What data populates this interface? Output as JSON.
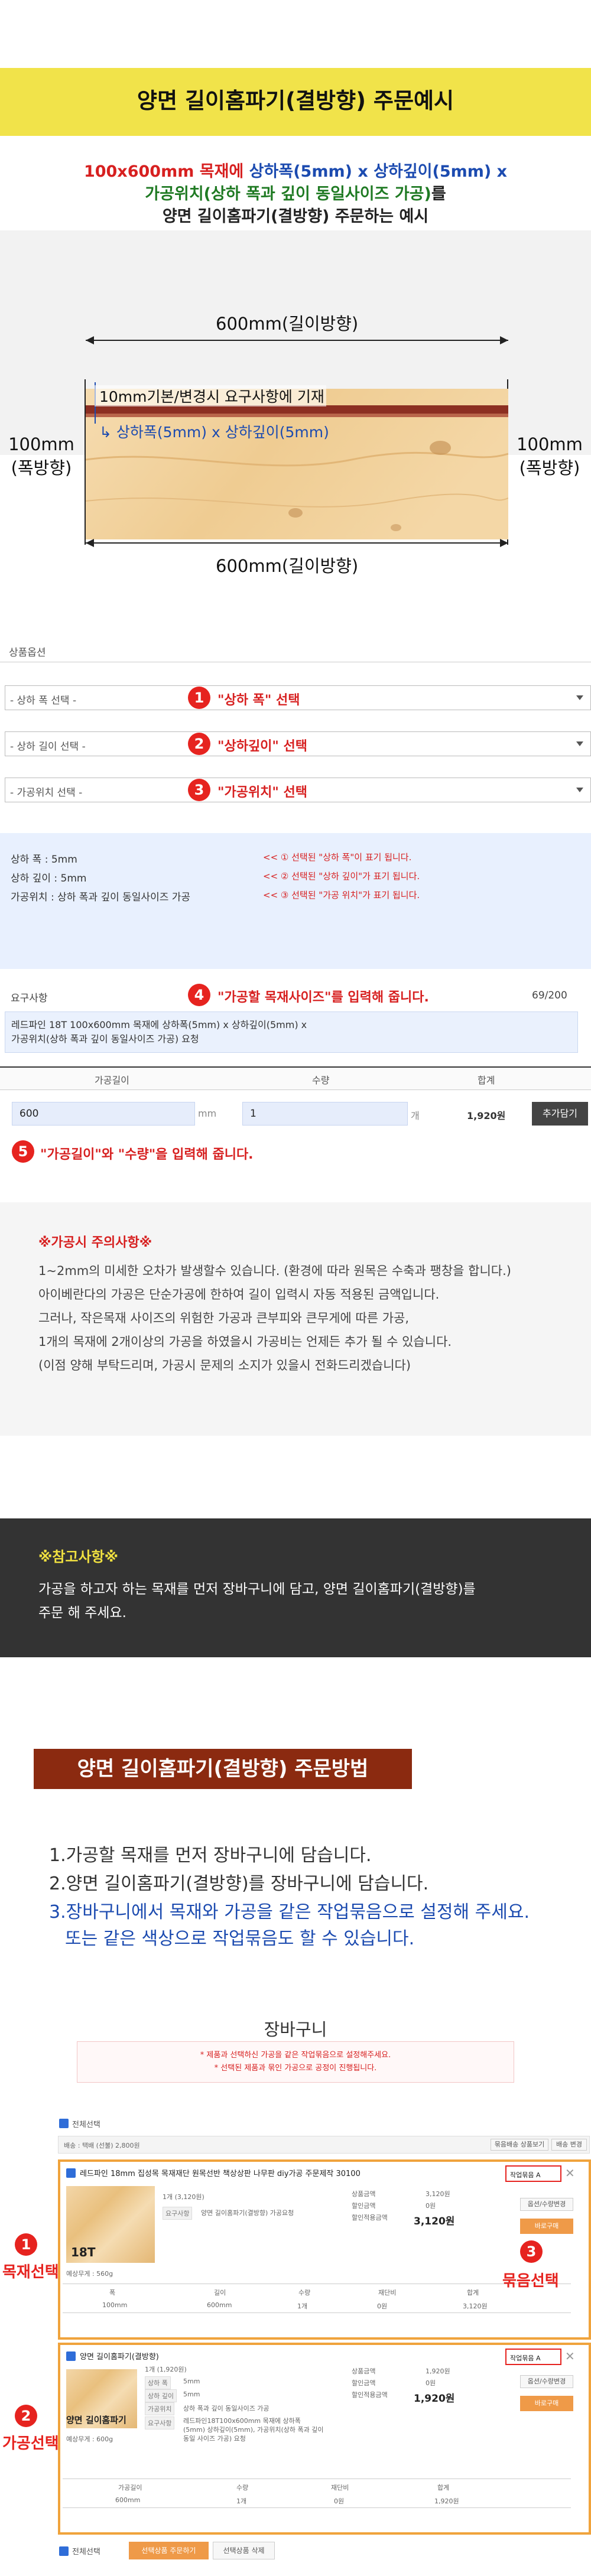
{
  "header": {
    "title": "양면 길이홈파기(결방향) 주문예시"
  },
  "intro": {
    "line1_a": "100x600mm 목재에 ",
    "line1_b": "상하폭(5mm) x 상하깊이(5mm) x",
    "line2_a": "가공위치(상하 폭과 깊이 동일사이즈 가공)",
    "line2_b": "를",
    "line3": "양면 길이홈파기(결방향) 주문하는 예시"
  },
  "diagram": {
    "top_dim": "600mm(길이방향)",
    "bottom_dim": "600mm(길이방향)",
    "left_dim_1": "100mm",
    "left_dim_2": "(폭방향)",
    "right_dim_1": "100mm",
    "right_dim_2": "(폭방향)",
    "groove_label": "10mm기본/변경시 요구사항에 기재",
    "groove_size": "상하폭(5mm) x 상하깊이(5mm)",
    "colors": {
      "groove": "#8c2f22",
      "annotation": "#1c4bb0",
      "wood": "#f2d6a8"
    }
  },
  "options": {
    "section_label": "상품옵션",
    "select1": "- 상하 폭 선택 -",
    "select2": "- 상하 길이 선택 -",
    "select3": "- 가공위치 선택 -",
    "note1": "\"상하 폭\" 선택",
    "note2": "\"상하깊이\" 선택",
    "note3": "\"가공위치\" 선택",
    "badges": [
      "1",
      "2",
      "3",
      "4",
      "5"
    ]
  },
  "selected": {
    "row1": "상하 폭 : 5mm",
    "row2": "상하 깊이 : 5mm",
    "row3": "가공위치 : 상하 폭과 깊이 동일사이즈 가공",
    "hint1": "<< ① 선택된 \"상하 폭\"이 표기 됩니다.",
    "hint2": "<< ② 선택된 \"상하 깊이\"가 표기 됩니다.",
    "hint3": "<< ③ 선택된 \"가공 위치\"가 표기 됩니다."
  },
  "request": {
    "label": "요구사항",
    "note": "\"가공할 목재사이즈\"를 입력해 줍니다.",
    "count": "69/200",
    "text1": "레드파인 18T 100x600mm 목재에 상하폭(5mm) x 상하깊이(5mm) x",
    "text2": "가공위치(상하 폭과 깊이 동일사이즈 가공) 요청"
  },
  "order_table": {
    "col_length": "가공길이",
    "col_qty": "수량",
    "col_total": "합계",
    "length_value": "600",
    "length_unit": "mm",
    "qty_value": "1",
    "qty_unit": "개",
    "price": "1,920원",
    "add_button": "추가담기",
    "note": "\"가공길이\"와 \"수량\"을 입력해 줍니다."
  },
  "caution": {
    "title": "※가공시 주의사항※",
    "lines": [
      "1~2mm의 미세한 오차가 발생할수 있습니다. (환경에 따라 원목은 수축과 팽창을 합니다.)",
      "아이베란다의 가공은 단순가공에 한하여 길이 입력시 자동 적용된 금액입니다.",
      "그러나, 작은목재 사이즈의 위험한 가공과 큰부피와 큰무게에 따른 가공,",
      "1개의 목재에 2개이상의 가공을 하였을시 가공비는 언제든 추가 될 수 있습니다.",
      "(이점 양해 부탁드리며, 가공시 문제의 소지가 있을시 전화드리겠습니다)"
    ]
  },
  "reference": {
    "title": "※참고사항※",
    "line1": "가공을 하고자 하는 목재를 먼저 장바구니에 담고, 양면 길이홈파기(결방향)를",
    "line2": "주문 해 주세요."
  },
  "method": {
    "banner": "양면 길이홈파기(결방향) 주문방법",
    "step1": "1.가공할 목재를 먼저 장바구니에 담습니다.",
    "step2": "2.양면 길이홈파기(결방향)를 장바구니에 담습니다.",
    "step3a": "3.장바구니에서 목재와 가공을 같은 작업묶음으로 설정해 주세요.",
    "step3b": "또는 같은 색상으로 작업묶음도 할 수 있습니다."
  },
  "cart": {
    "title": "장바구니",
    "notice1": "* 제품과 선택하신 가공을 같은 작업묶음으로 설정해주세요.",
    "notice2": "* 선택된 제품과 묶인 가공으로 공정이 진행됩니다.",
    "select_all": "전체선택",
    "shipping": "배송 : 택배 (선불) 2,800원",
    "btn_group": "묶음배송 상품보기",
    "btn_ship": "배송 변경",
    "item1": {
      "name": "레드파인 18mm 집성목 목재재단 원목선반 책상상판 나무판 diy가공 주문제작 30100",
      "opt_qty": "1개 (3,120원)",
      "opt_tag": "요구사항",
      "opt_req": "양면 길이홈파기(결방향) 가공요청",
      "thumb": "18T",
      "weight": "예상무게 : 560g",
      "sum_labels": [
        "상품금액",
        "할인금액",
        "할인적용금액"
      ],
      "sum_values": [
        "3,120원",
        "0원",
        "3,120원"
      ],
      "group_btn": "작업묶음 A",
      "btn_change": "옵션/수량변경",
      "btn_buy": "바로구매",
      "tbl_head": [
        "폭",
        "길이",
        "수량",
        "재단비",
        "합계"
      ],
      "tbl_vals": [
        "100mm",
        "600mm",
        "1개",
        "0원",
        "3,120원"
      ]
    },
    "item2": {
      "name": "양면 길이홈파기(결방향)",
      "opt_qty": "1개 (1,920원)",
      "thumb": "양면 길이홈파기",
      "t1": "상하 폭",
      "v1": "5mm",
      "t2": "상하 깊이",
      "v2": "5mm",
      "t3": "가공위치",
      "v3": "상하 폭과 깊이 동일사이즈 가공",
      "t4": "요구사항",
      "v4a": "레드파인18T100x600mm 목재에 상하폭",
      "v4b": "(5mm) 상하깊이(5mm), 가공위치(상하 폭과 깊이",
      "v4c": "동일 사이즈 가공) 요청",
      "weight": "예상무게 : 600g",
      "sum_labels": [
        "상품금액",
        "할인금액",
        "할인적용금액"
      ],
      "sum_values": [
        "1,920원",
        "0원",
        "1,920원"
      ],
      "group_btn": "작업묶음 A",
      "btn_change": "옵션/수량변경",
      "btn_buy": "바로구매",
      "tbl_head": [
        "가공길이",
        "수량",
        "재단비",
        "합계"
      ],
      "tbl_vals": [
        "600mm",
        "1개",
        "0원",
        "1,920원"
      ]
    },
    "side_labels": {
      "wood": "목재선택",
      "proc": "가공선택",
      "group": "묶음선택"
    },
    "bottom": {
      "select_all": "전체선택",
      "btn_order": "선택상품 주문하기",
      "btn_delete": "선택상품 삭제"
    }
  }
}
